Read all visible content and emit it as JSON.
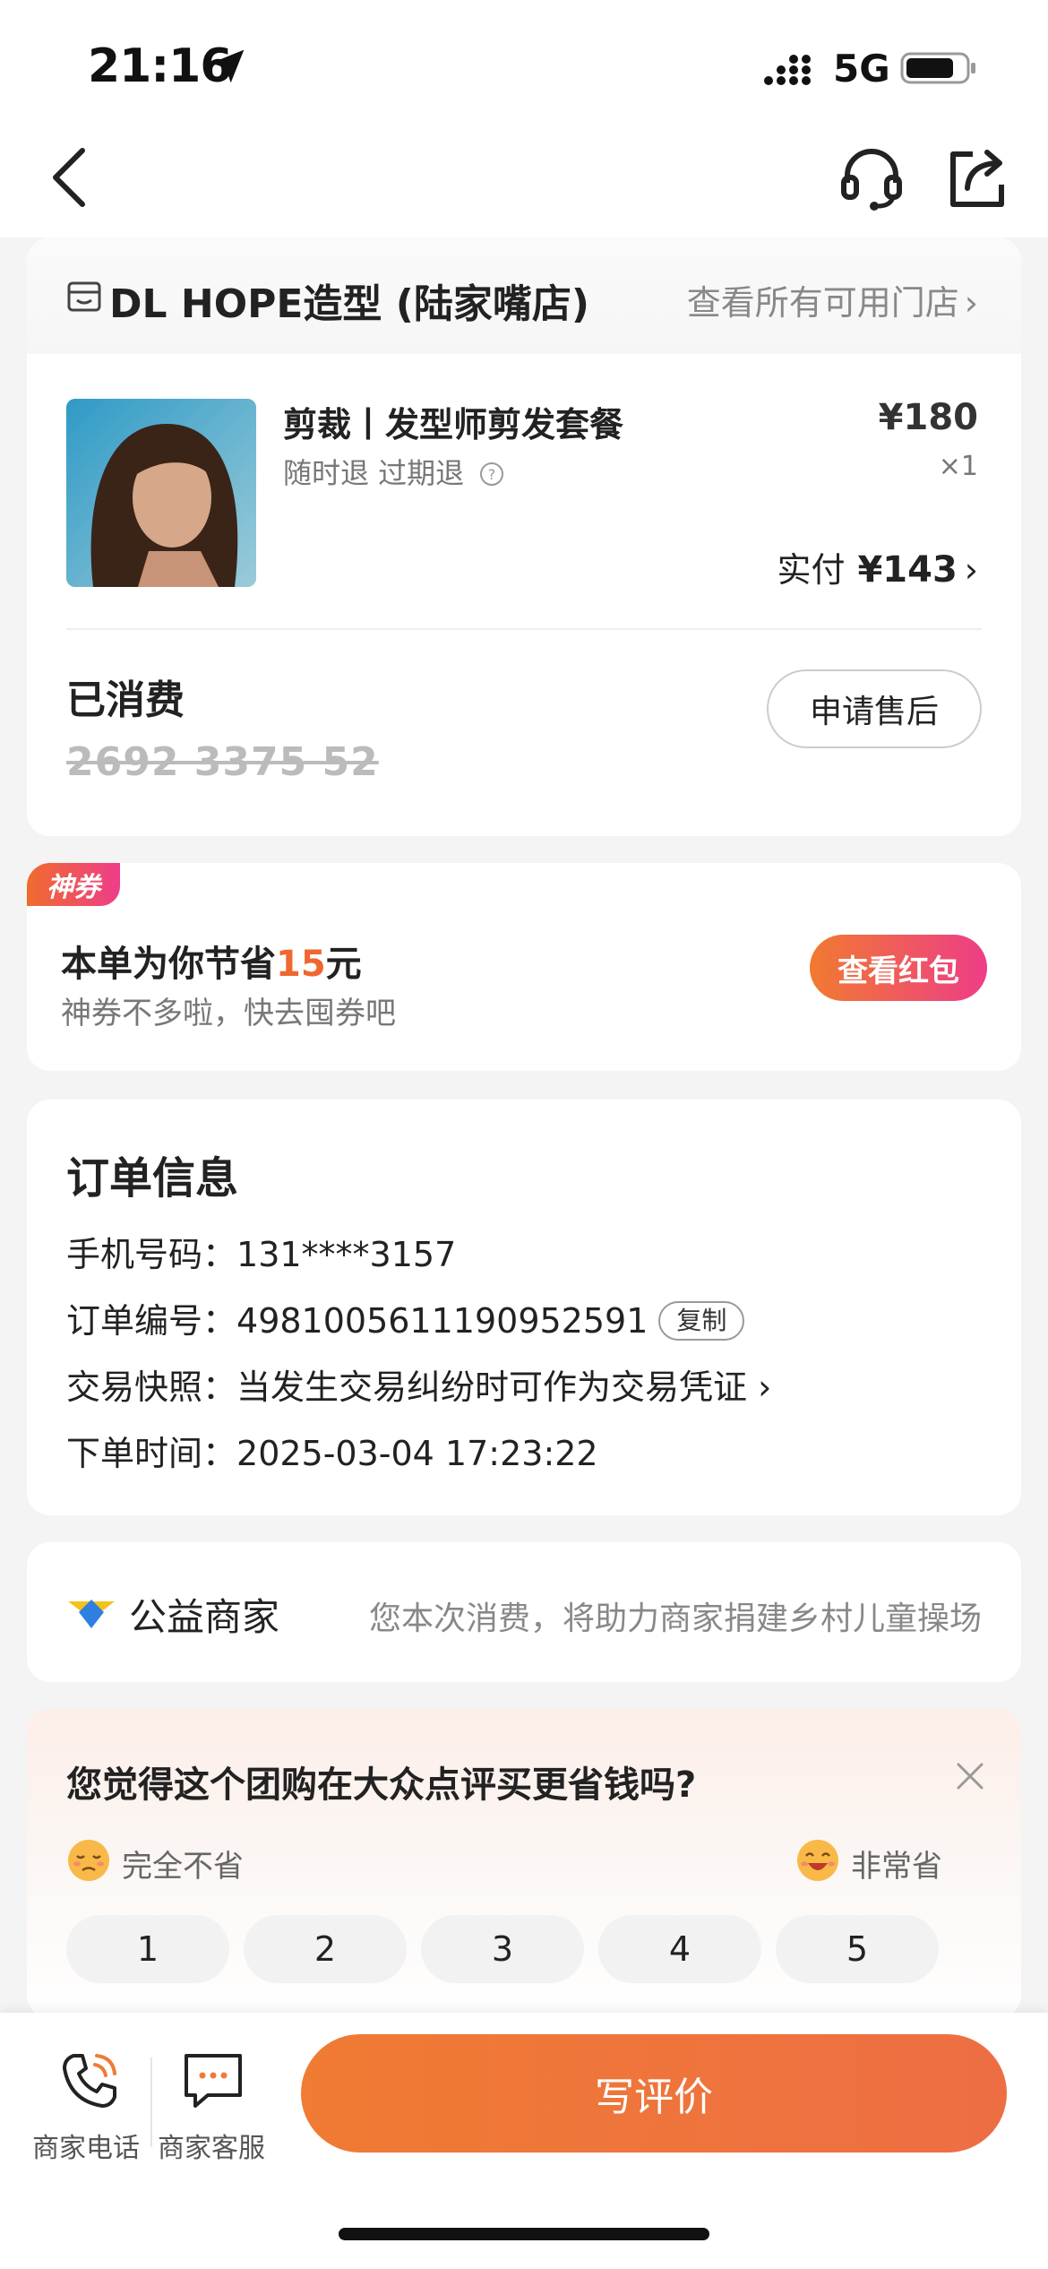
{
  "status_bar": {
    "time": "21:16",
    "network": "5G"
  },
  "store": {
    "name": "DL HOPE造型 (陆家嘴店)",
    "all_stores_link": "查看所有可用门店",
    "product": {
      "title": "剪裁丨发型师剪发套餐",
      "tags": "随时退 过期退",
      "price": "¥180",
      "qty": "×1",
      "paid_label": "实付",
      "paid_amount": "¥143"
    },
    "status": "已消费",
    "voucher_code": "2692 3375 52",
    "aftersale_button": "申请售后"
  },
  "coupon": {
    "badge": "神券",
    "save_prefix": "本单为你节省",
    "save_amount": "15",
    "save_suffix": "元",
    "subtitle": "神券不多啦，快去囤券吧",
    "button": "查看红包"
  },
  "order_info": {
    "title": "订单信息",
    "phone_label": "手机号码：",
    "phone_value": "131****3157",
    "order_no_label": "订单编号：",
    "order_no_value": "4981005611190952591",
    "copy_button": "复制",
    "snapshot_label": "交易快照：",
    "snapshot_value": "当发生交易纠纷时可作为交易凭证",
    "time_label": "下单时间：",
    "time_value": "2025-03-04 17:23:22"
  },
  "charity": {
    "title": "公益商家",
    "description": "您本次消费，将助力商家捐建乡村儿童操场"
  },
  "survey": {
    "question": "您觉得这个团购在大众点评买更省钱吗?",
    "low_label": "完全不省",
    "high_label": "非常省",
    "ratings": [
      "1",
      "2",
      "3",
      "4",
      "5"
    ]
  },
  "bottom_bar": {
    "phone_label": "商家电话",
    "chat_label": "商家客服",
    "review_button": "写评价"
  },
  "colors": {
    "accent": "#f0662f",
    "pink": "#ee3d88"
  }
}
